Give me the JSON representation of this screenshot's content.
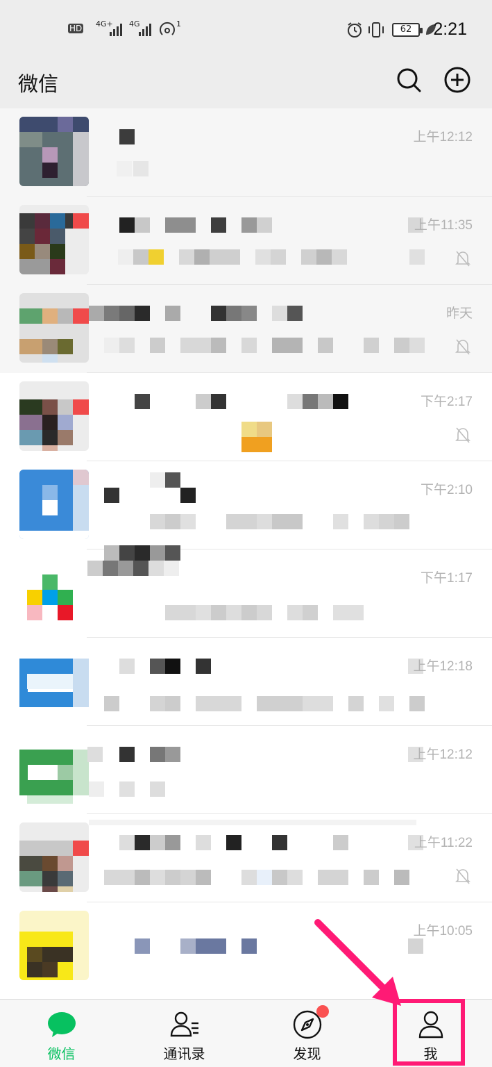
{
  "status_bar": {
    "hd": "HD",
    "net1": "4G+",
    "net2": "4G",
    "hotspot_count": "1",
    "battery": "62",
    "time": "2:21"
  },
  "header": {
    "title": "微信",
    "search_icon": "search-icon",
    "add_icon": "plus-circle-icon"
  },
  "chats": [
    {
      "time": "上午12:12",
      "muted": false
    },
    {
      "time": "上午11:35",
      "muted": true
    },
    {
      "time": "昨天",
      "muted": true
    },
    {
      "time": "下午2:17",
      "muted": true
    },
    {
      "time": "下午2:10",
      "muted": false
    },
    {
      "time": "下午1:17",
      "muted": false
    },
    {
      "time": "上午12:18",
      "muted": false
    },
    {
      "time": "上午12:12",
      "muted": false
    },
    {
      "time": "上午11:22",
      "muted": true
    },
    {
      "time": "上午10:05",
      "muted": false
    }
  ],
  "tabs": [
    {
      "label": "微信",
      "icon": "chat-bubble-icon",
      "active": true
    },
    {
      "label": "通讯录",
      "icon": "contacts-icon",
      "active": false
    },
    {
      "label": "发现",
      "icon": "compass-icon",
      "active": false,
      "badge": "red-dot"
    },
    {
      "label": "我",
      "icon": "person-icon",
      "active": false
    }
  ],
  "colors": {
    "accent": "#07c160",
    "highlight": "#ff1a75",
    "badge": "#fa5151"
  }
}
